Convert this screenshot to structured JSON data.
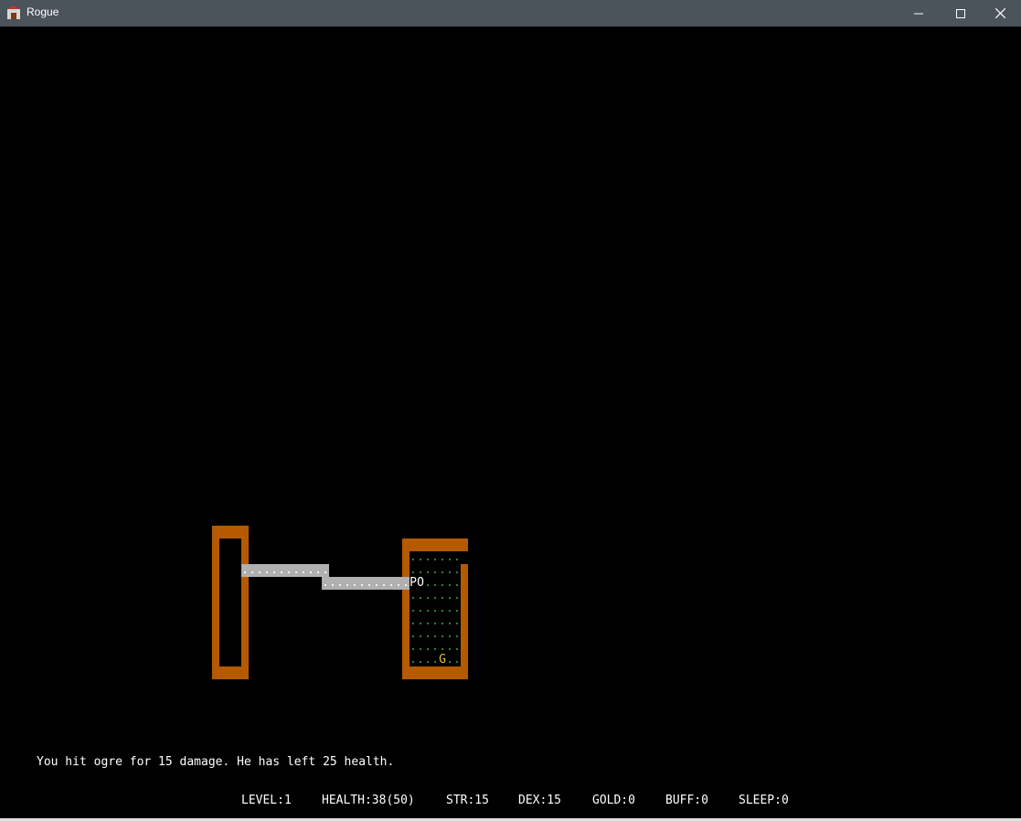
{
  "window": {
    "title": "Rogue",
    "icon": "rogue-app-icon"
  },
  "controls": {
    "minimize_icon": "minimize-icon",
    "maximize_icon": "maximize-icon",
    "close_icon": "close-icon"
  },
  "map": {
    "floor_glyph": ".",
    "corridor_glyph": ".",
    "player_glyph": "P",
    "monster_glyph": "O",
    "gold_glyph": "G",
    "colors": {
      "wall": "#b55a00",
      "floor": "#3aa23a",
      "corridor": "#b0b0b0",
      "gold": "#d8c33a"
    }
  },
  "message": "You hit ogre for 15 damage. He has left 25 health.",
  "stats": {
    "level": "LEVEL:1",
    "health": "HEALTH:38(50)",
    "str": "STR:15",
    "dex": "DEX:15",
    "gold": "GOLD:0",
    "buff": "BUFF:0",
    "sleep": "SLEEP:0"
  }
}
